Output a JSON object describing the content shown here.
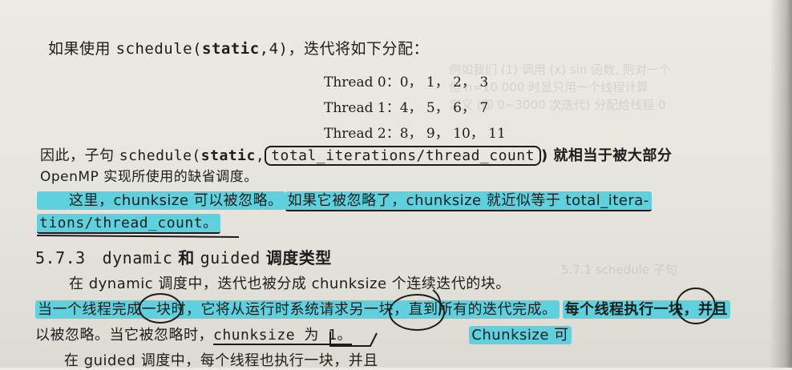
{
  "intro": {
    "prefix": "如果使用",
    "code": "schedule(",
    "code_bold": "static",
    "code_rest": ",4)",
    "suffix": "，迭代将如下分配："
  },
  "threads": [
    "Thread 0：0， 1， 2， 3",
    "Thread 1：4， 5， 6， 7",
    "Thread 2：8， 9， 10， 11"
  ],
  "para1": {
    "prefix": "因此，子句",
    "code_a": "schedule(",
    "code_bold": "static",
    "code_b": ",",
    "boxed_code": "total_iterations/thread_count",
    "suffix": ") 就相当于被大部分",
    "line2": "OpenMP 实现所使用的缺省调度。"
  },
  "para2": {
    "hl_part1": "这里，chunksize 可以被忽略。",
    "hl_part2": "如果它被忽略了，chunksize 就近似等于 total_itera-",
    "line2": "tions/thread_count。"
  },
  "section": {
    "number": "5.7.3",
    "title_code1": "dynamic",
    "title_and": "和",
    "title_code2": "guided",
    "title_rest": "调度类型"
  },
  "para3": {
    "line1": "在 dynamic 调度中，迭代也被分成 chunksize 个连续迭代的块。",
    "line2_hl": "当一个线程完成一块时，它将从运行时系统请求另一块，直到所有的迭代完成。",
    "line2_hl2": "每个线程执行一块，并且",
    "line3_prefix": "以被忽略。当它被忽略时，",
    "line3_code": "chunksize 为 1。",
    "line3_suffix": "Chunksize 可"
  },
  "para4": {
    "line1": "在 guided 调度中，每个线程也执行一块，并且"
  },
  "colors": {
    "highlighter": "#5fd0de",
    "pen": "#1b1b1b",
    "paper": "#e8e6df"
  }
}
